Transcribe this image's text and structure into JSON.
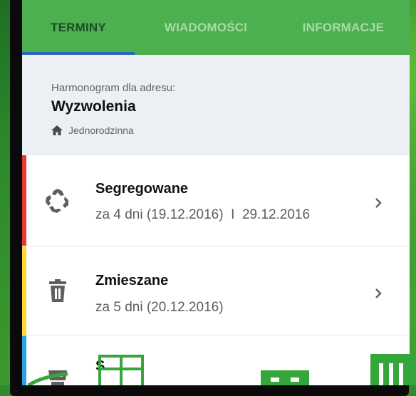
{
  "tabs": [
    {
      "label": "TERMINY",
      "active": true
    },
    {
      "label": "WIADOMOŚCI",
      "active": false
    },
    {
      "label": "INFORMACJE",
      "active": false
    }
  ],
  "header": {
    "label": "Harmonogram dla adresu:",
    "street": "Wyzwolenia",
    "type_icon": "home-icon",
    "type": "Jednorodzinna"
  },
  "rows": [
    {
      "icon": "recycle-icon",
      "title": "Segregowane",
      "subtitle": "za 4 dni (19.12.2016)  I  29.12.2016",
      "color": "#e53935"
    },
    {
      "icon": "trash-icon",
      "title": "Zmieszane",
      "subtitle": "za 5 dni (20.12.2016)",
      "color": "#fdd835"
    },
    {
      "icon": "bin-icon",
      "title": "S",
      "color": "#29a3e0"
    }
  ],
  "colors": {
    "tab_bar": "#4caf50",
    "tab_active_text": "#1d4d22",
    "tab_inactive_text": "#a6dca4",
    "tab_indicator": "#2f64b9",
    "header_bg": "#eceff4"
  }
}
